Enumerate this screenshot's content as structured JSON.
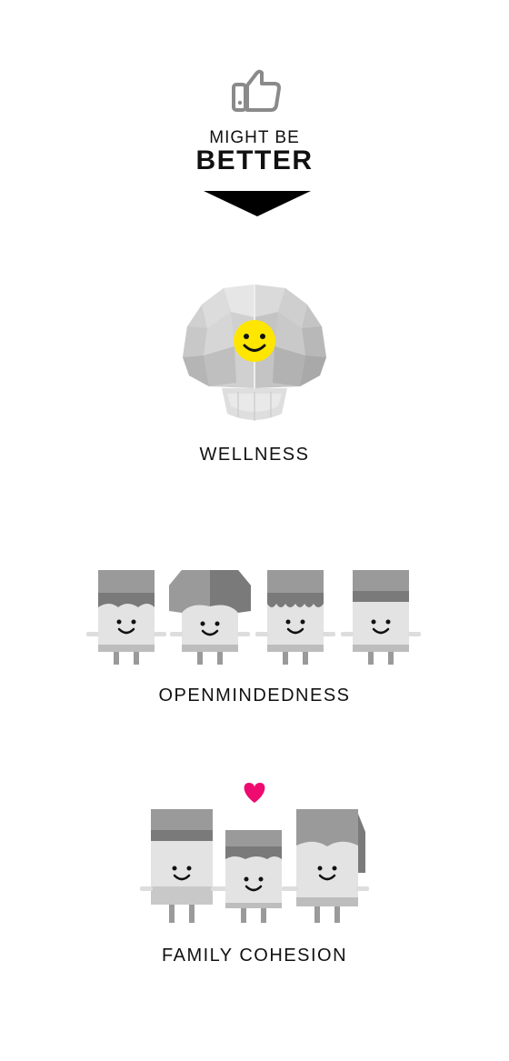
{
  "header": {
    "icon": "thumbs-up-icon",
    "subtitle": "MIGHT BE",
    "title": "BETTER"
  },
  "sections": [
    {
      "icon": "smiling-brain-icon",
      "label": "WELLNESS"
    },
    {
      "icon": "four-children-icon",
      "label": "OPENMINDEDNESS"
    },
    {
      "icon": "family-with-heart-icon",
      "label": "FAMILY COHESION"
    }
  ],
  "colors": {
    "text": "#111111",
    "icon_gray": "#8a8a8a",
    "smiley_yellow": "#ffe600",
    "heart_pink": "#ee0a6f"
  }
}
